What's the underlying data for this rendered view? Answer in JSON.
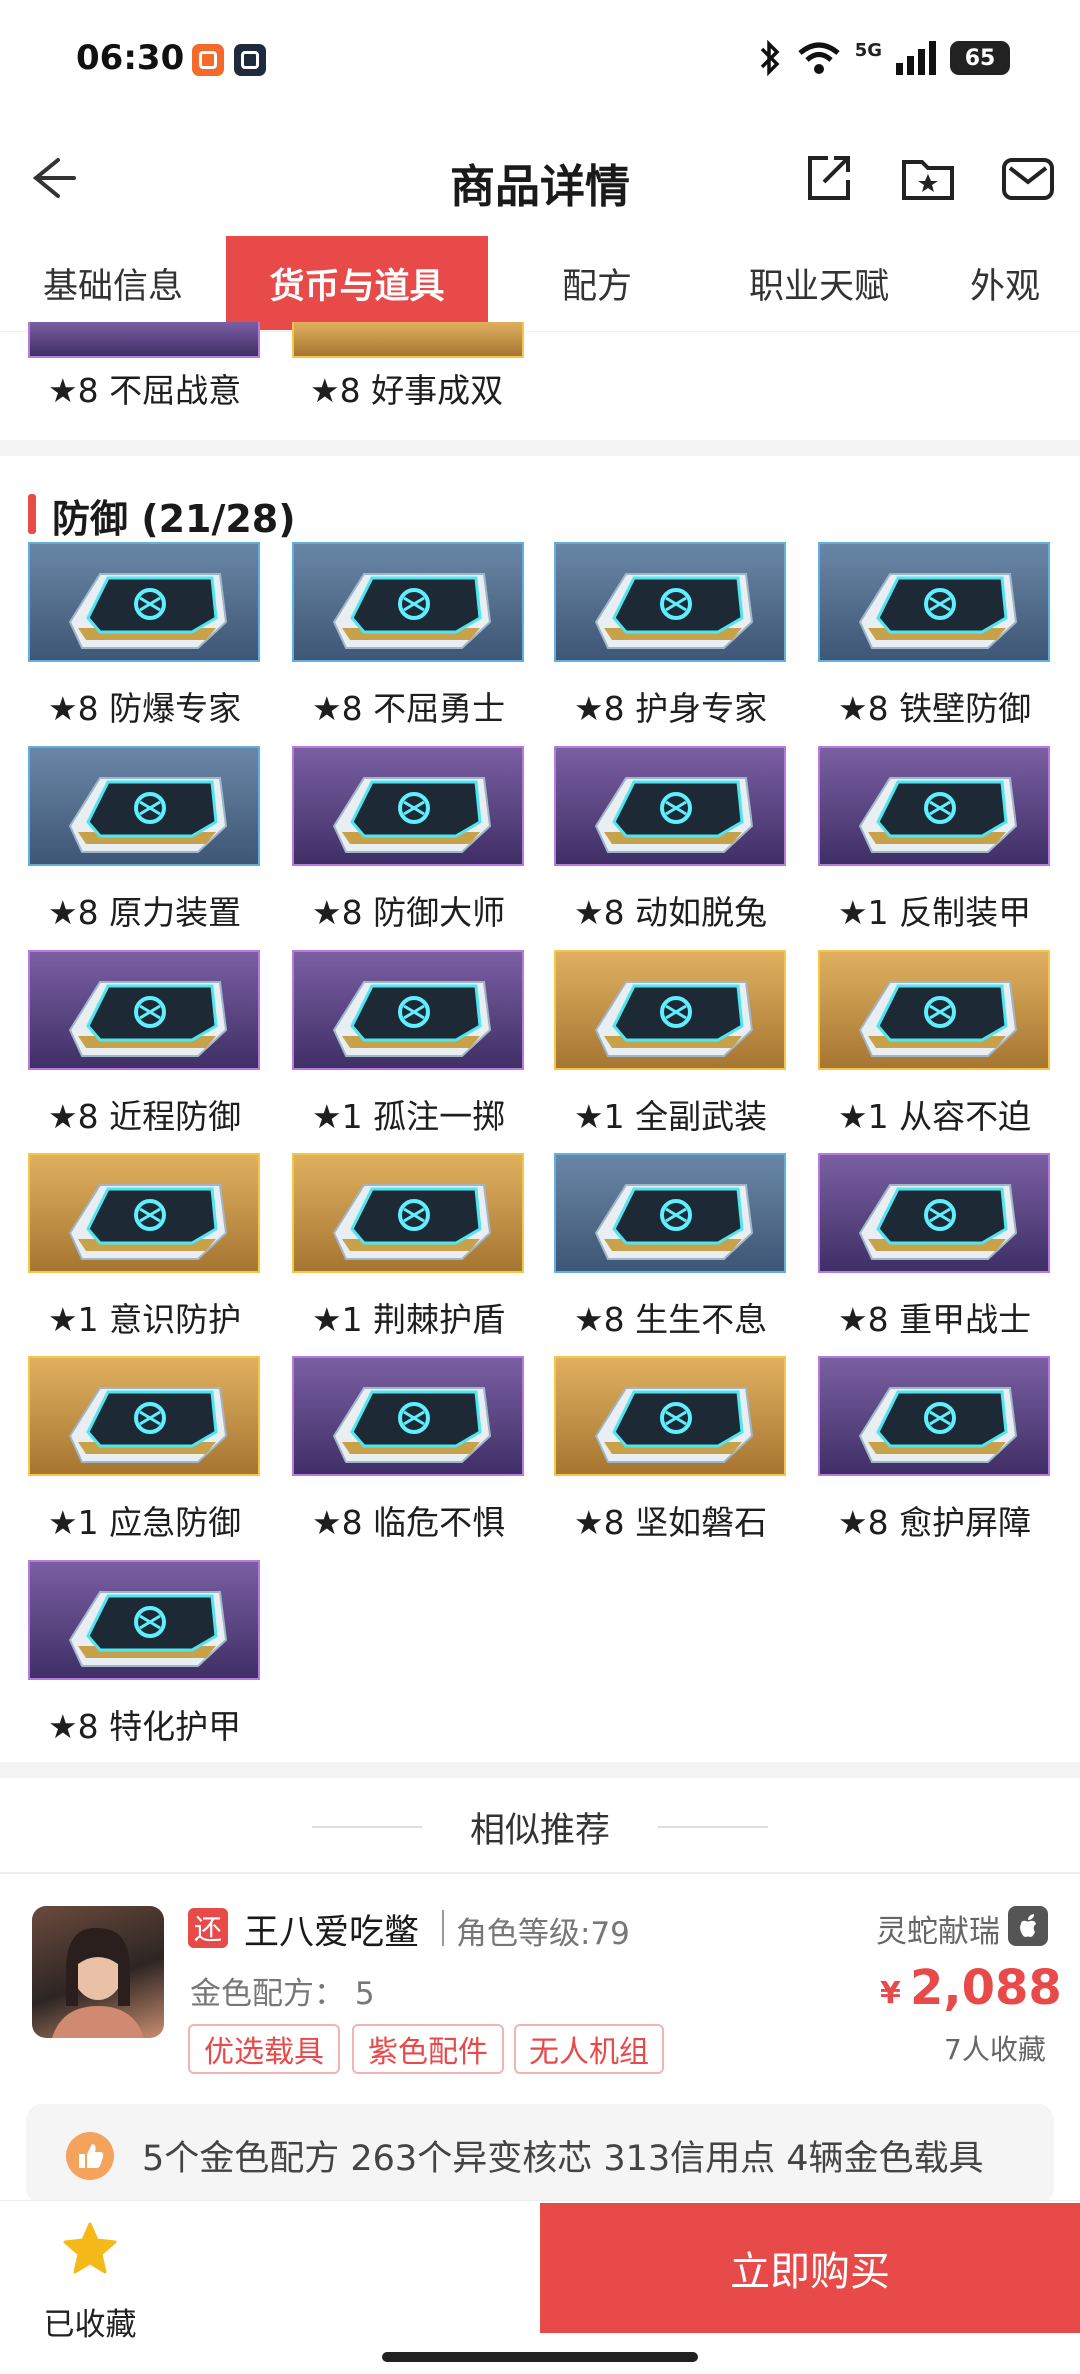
{
  "status_bar": {
    "time": "06:30",
    "network": "5G",
    "battery": "65"
  },
  "header": {
    "title": "商品详情"
  },
  "tabs": [
    {
      "label": "基础信息",
      "active": false
    },
    {
      "label": "货币与道具",
      "active": true
    },
    {
      "label": "配方",
      "active": false
    },
    {
      "label": "职业天赋",
      "active": false
    },
    {
      "label": "外观",
      "active": false
    }
  ],
  "prev_section_items": [
    {
      "label": "★8 不屈战意",
      "rarity": "purple"
    },
    {
      "label": "★8 好事成双",
      "rarity": "gold"
    }
  ],
  "defense_section": {
    "title": "防御 (21/28)",
    "items": [
      {
        "label": "★8 防爆专家",
        "rarity": "blue"
      },
      {
        "label": "★8 不屈勇士",
        "rarity": "blue"
      },
      {
        "label": "★8 护身专家",
        "rarity": "blue"
      },
      {
        "label": "★8 铁壁防御",
        "rarity": "blue"
      },
      {
        "label": "★8 原力装置",
        "rarity": "blue"
      },
      {
        "label": "★8 防御大师",
        "rarity": "purple"
      },
      {
        "label": "★8 动如脱兔",
        "rarity": "purple"
      },
      {
        "label": "★1 反制装甲",
        "rarity": "purple"
      },
      {
        "label": "★8 近程防御",
        "rarity": "purple"
      },
      {
        "label": "★1 孤注一掷",
        "rarity": "purple"
      },
      {
        "label": "★1 全副武装",
        "rarity": "gold"
      },
      {
        "label": "★1 从容不迫",
        "rarity": "gold"
      },
      {
        "label": "★1 意识防护",
        "rarity": "gold"
      },
      {
        "label": "★1 荆棘护盾",
        "rarity": "gold"
      },
      {
        "label": "★8 生生不息",
        "rarity": "blue"
      },
      {
        "label": "★8 重甲战士",
        "rarity": "purple"
      },
      {
        "label": "★1 应急防御",
        "rarity": "gold"
      },
      {
        "label": "★8 临危不惧",
        "rarity": "purple"
      },
      {
        "label": "★8 坚如磐石",
        "rarity": "gold"
      },
      {
        "label": "★8 愈护屏障",
        "rarity": "purple"
      },
      {
        "label": "★8 特化护甲",
        "rarity": "purple"
      }
    ]
  },
  "recommend": {
    "title": "相似推荐",
    "listing": {
      "tag": "还",
      "seller": "王八爱吃鳖",
      "level": "角色等级:79",
      "server": "灵蛇献瑞",
      "meta": "金色配方：  5",
      "tags": [
        "优选载具",
        "紫色配件",
        "无人机组"
      ],
      "currency": "¥",
      "price": "2,088",
      "fav_count": "7人收藏"
    },
    "description": "5个金色配方 263个异变核芯 313信用点 4辆金色载具"
  },
  "bottom": {
    "fav_label": "已收藏",
    "buy_label": "立即购买"
  },
  "colors": {
    "accent": "#e84a4a",
    "blue": "#5fb2de",
    "purple": "#b77be0",
    "gold": "#f3c84a"
  }
}
